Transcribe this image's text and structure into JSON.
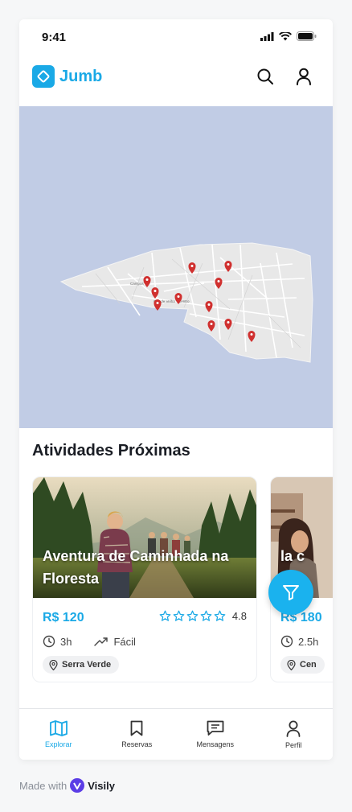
{
  "status_bar": {
    "time": "9:41"
  },
  "header": {
    "logo_text": "Jumb",
    "icons": [
      "search-icon",
      "user-icon"
    ]
  },
  "map": {
    "street_labels": [
      "Campus",
      "Cidade Velha",
      "Centro"
    ]
  },
  "section": {
    "title": "Atividades Próximas"
  },
  "cards": [
    {
      "title": "Aventura de Caminhada na Floresta",
      "price": "R$ 120",
      "rating": "4.8",
      "duration": "3h",
      "difficulty": "Fácil",
      "location": "Serra Verde"
    },
    {
      "title": "la c",
      "price": "R$ 180",
      "duration": "2.5h",
      "location": "Cen"
    }
  ],
  "bottom_nav": [
    {
      "label": "Explorar",
      "icon": "map-icon",
      "active": true
    },
    {
      "label": "Reservas",
      "icon": "bookmark-icon",
      "active": false
    },
    {
      "label": "Mensagens",
      "icon": "message-icon",
      "active": false
    },
    {
      "label": "Perfil",
      "icon": "profile-icon",
      "active": false
    }
  ],
  "footer": {
    "made_with": "Made with",
    "brand": "Visily"
  },
  "colors": {
    "accent": "#1aa9e6",
    "map_water": "#c1cce5",
    "pin": "#d0302f"
  }
}
